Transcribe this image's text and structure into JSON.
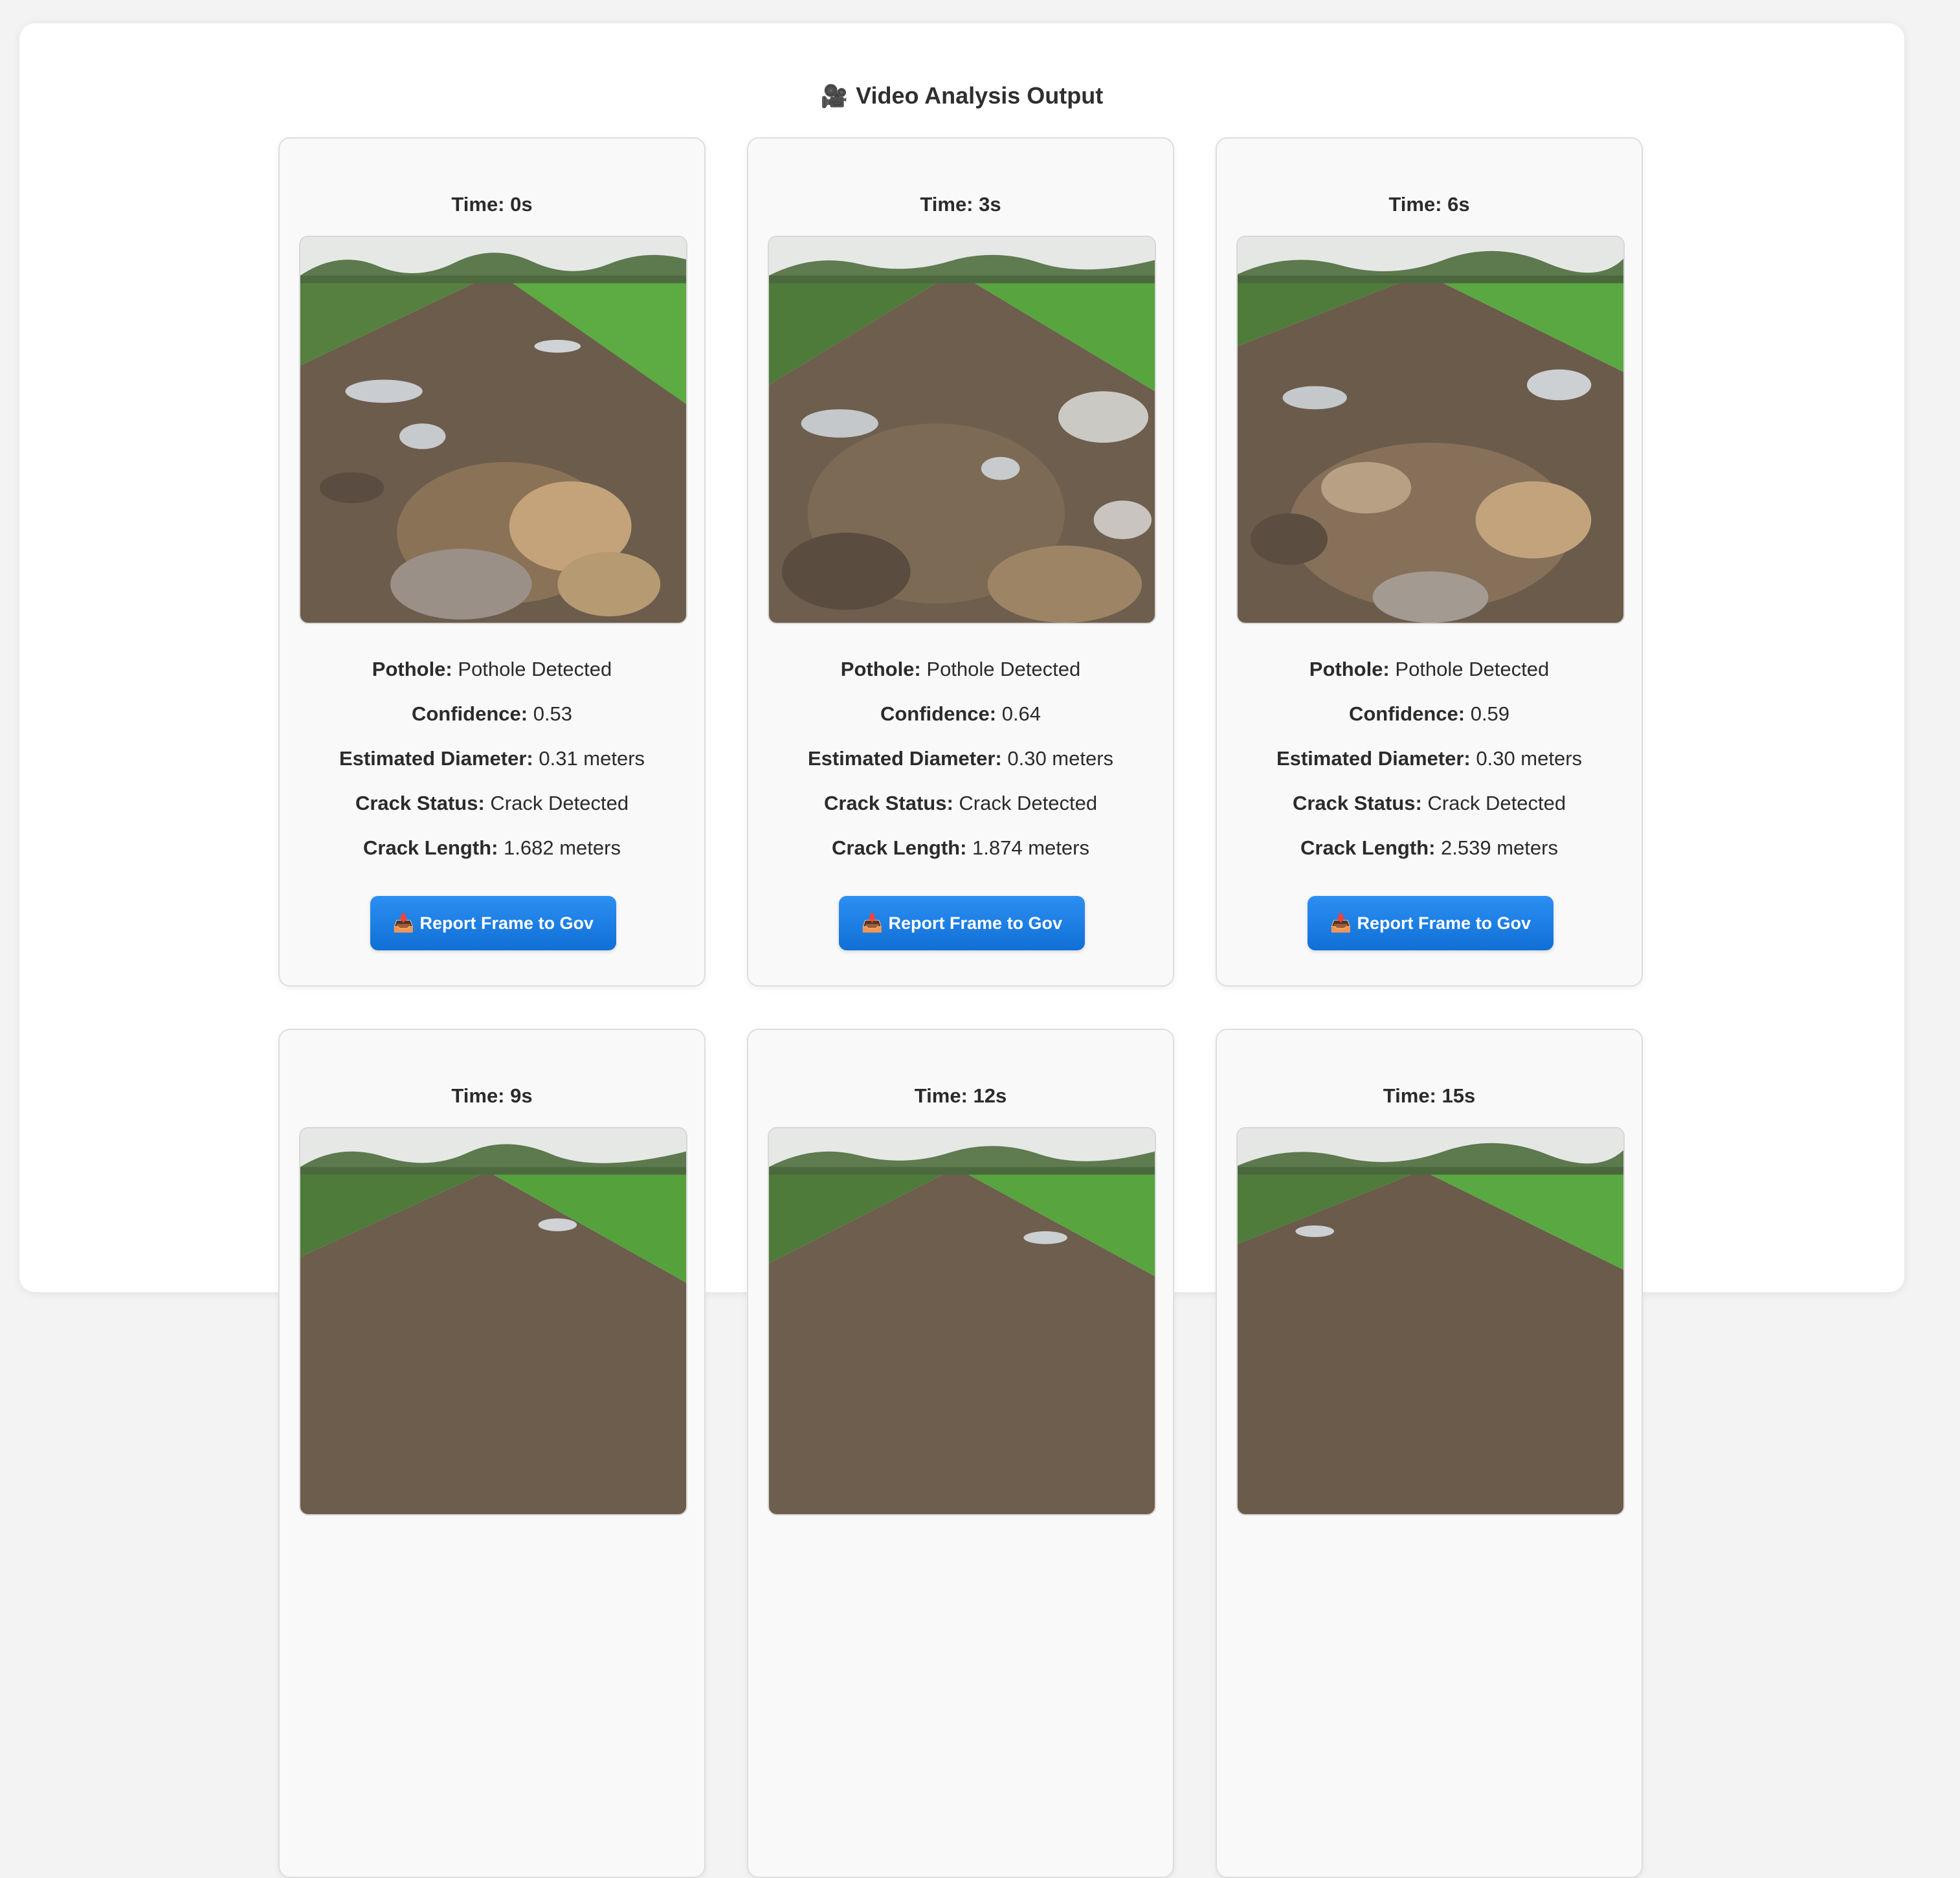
{
  "header": {
    "icon": "video-camera-icon",
    "title": "Video Analysis Output"
  },
  "labels": {
    "pothole": "Pothole:",
    "confidence": "Confidence:",
    "diameter": "Estimated Diameter:",
    "crack_status": "Crack Status:",
    "crack_length": "Crack Length:"
  },
  "cards": [
    {
      "time": "Time: 0s",
      "pothole": "Pothole Detected",
      "confidence": "0.53",
      "diameter": "0.31 meters",
      "crack_status": "Crack Detected",
      "crack_length": "1.682 meters",
      "button": "Report Frame to Gov"
    },
    {
      "time": "Time: 3s",
      "pothole": "Pothole Detected",
      "confidence": "0.64",
      "diameter": "0.30 meters",
      "crack_status": "Crack Detected",
      "crack_length": "1.874 meters",
      "button": "Report Frame to Gov"
    },
    {
      "time": "Time: 6s",
      "pothole": "Pothole Detected",
      "confidence": "0.59",
      "diameter": "0.30 meters",
      "crack_status": "Crack Detected",
      "crack_length": "2.539 meters",
      "button": "Report Frame to Gov"
    },
    {
      "time": "Time: 9s"
    },
    {
      "time": "Time: 12s"
    },
    {
      "time": "Time: 15s"
    }
  ],
  "colors": {
    "button_top": "#2d8ff2",
    "button_bottom": "#0f6fd6",
    "card_bg": "#f9f9f9",
    "page_bg": "#f3f3f3"
  }
}
